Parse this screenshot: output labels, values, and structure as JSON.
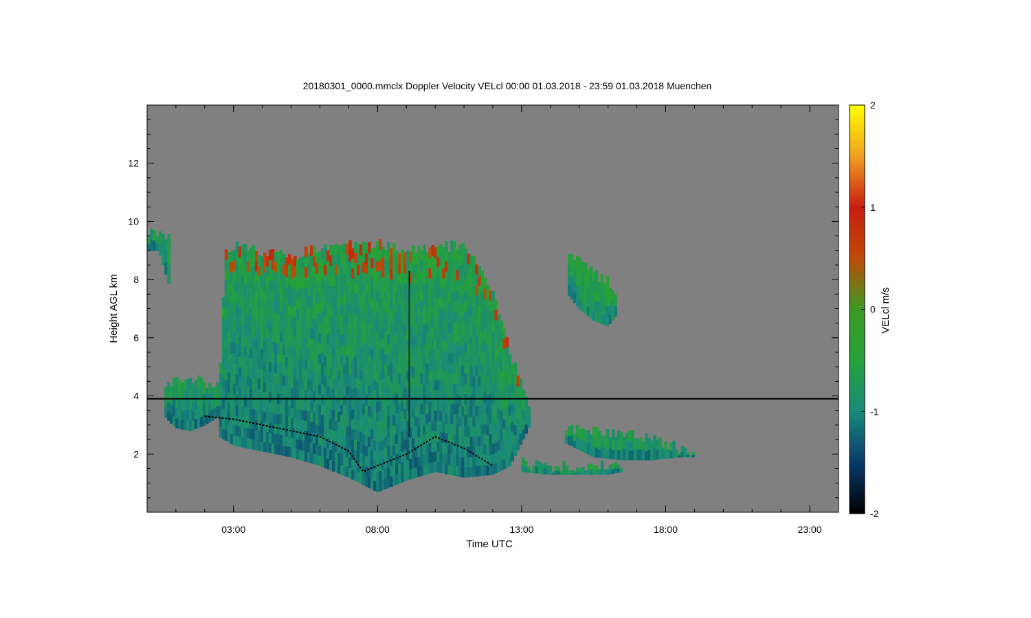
{
  "chart_data": {
    "type": "heatmap",
    "title": "20180301_0000.mmclx Doppler Velocity VELcl   00:00 01.03.2018 - 23:59 01.03.2018 Muenchen",
    "xlabel": "Time UTC",
    "ylabel": "Height AGL km",
    "colorbar_label": "VELcl m/s",
    "xlim": [
      "00:00",
      "24:00"
    ],
    "xlim_hours": [
      0,
      24
    ],
    "ylim": [
      0,
      14
    ],
    "clim": [
      -2,
      2
    ],
    "x_ticks": [
      {
        "value": 3,
        "label": "03:00"
      },
      {
        "value": 8,
        "label": "08:00"
      },
      {
        "value": 13,
        "label": "13:00"
      },
      {
        "value": 18,
        "label": "18:00"
      },
      {
        "value": 23,
        "label": "23:00"
      }
    ],
    "y_ticks": [
      {
        "value": 2,
        "label": "2"
      },
      {
        "value": 4,
        "label": "4"
      },
      {
        "value": 6,
        "label": "6"
      },
      {
        "value": 8,
        "label": "8"
      },
      {
        "value": 10,
        "label": "10"
      },
      {
        "value": 12,
        "label": "12"
      }
    ],
    "colorbar_ticks": [
      {
        "value": 2,
        "label": "2"
      },
      {
        "value": 1,
        "label": "1"
      },
      {
        "value": 0,
        "label": "0"
      },
      {
        "value": -1,
        "label": "-1"
      },
      {
        "value": -2,
        "label": "-2"
      }
    ],
    "colormap": [
      "#000000",
      "#083a6c",
      "#1a8a7a",
      "#26a23a",
      "#3c9a24",
      "#c04a08",
      "#c81e10",
      "#f0a020",
      "#ffff00"
    ],
    "background_color": "#808080",
    "cloud_regions": [
      {
        "name": "main-cloud-system",
        "t": [
          2.5,
          2.7,
          3.0,
          4.0,
          5.0,
          6.0,
          7.0,
          8.0,
          9.0,
          10.0,
          11.0,
          12.0,
          12.6,
          13.3
        ],
        "top": [
          4.0,
          8.8,
          9.2,
          9.0,
          8.8,
          9.1,
          9.2,
          9.3,
          9.0,
          9.1,
          9.2,
          7.5,
          5.5,
          3.6
        ],
        "base": [
          2.6,
          2.5,
          2.3,
          2.1,
          1.9,
          1.6,
          1.2,
          0.7,
          1.1,
          1.4,
          1.2,
          1.3,
          1.6,
          3.0
        ],
        "mean_velocity": -0.6
      },
      {
        "name": "early-low-cloud",
        "t": [
          0.6,
          1.0,
          1.5,
          2.0,
          2.5
        ],
        "top": [
          4.4,
          4.6,
          4.6,
          4.5,
          4.3
        ],
        "base": [
          3.3,
          2.9,
          2.8,
          3.0,
          3.3
        ],
        "mean_velocity": -0.6
      },
      {
        "name": "early-high-cloud",
        "t": [
          0.0,
          0.4,
          0.8
        ],
        "top": [
          9.6,
          9.7,
          9.5
        ],
        "base": [
          9.0,
          9.0,
          7.7
        ],
        "mean_velocity": -0.5
      },
      {
        "name": "mid-level-cloud-14h-16h",
        "t": [
          14.6,
          15.0,
          15.5,
          16.0,
          16.3
        ],
        "top": [
          8.8,
          8.6,
          8.2,
          8.0,
          7.6
        ],
        "base": [
          7.5,
          7.0,
          6.6,
          6.4,
          6.8
        ],
        "mean_velocity": -0.4
      },
      {
        "name": "low-cloud-14h-19h",
        "t": [
          14.5,
          15.5,
          16.5,
          17.5,
          18.5,
          19.0
        ],
        "top": [
          2.9,
          2.8,
          2.7,
          2.5,
          2.2,
          2.0
        ],
        "base": [
          2.4,
          1.9,
          1.8,
          1.8,
          1.9,
          1.9
        ],
        "mean_velocity": -0.5
      },
      {
        "name": "low-cloud-13h-16h",
        "t": [
          13.0,
          14.0,
          15.0,
          16.0,
          16.5
        ],
        "top": [
          1.7,
          1.6,
          1.6,
          1.6,
          1.5
        ],
        "base": [
          1.4,
          1.3,
          1.3,
          1.3,
          1.4
        ],
        "mean_velocity": -0.5
      }
    ],
    "line_features": [
      {
        "name": "melting-layer-line",
        "t": [
          0,
          24
        ],
        "h": [
          3.9,
          3.9
        ]
      },
      {
        "name": "cloud-base-trace",
        "t": [
          2.0,
          3.0,
          4.0,
          5.0,
          6.0,
          7.0,
          7.5,
          8.0,
          9.0,
          10.0,
          11.0,
          12.0
        ],
        "h": [
          3.3,
          3.2,
          3.0,
          2.8,
          2.6,
          2.1,
          1.4,
          1.6,
          2.0,
          2.6,
          2.2,
          1.6
        ]
      },
      {
        "name": "vertical-artifact-line",
        "t": [
          9.1,
          9.1
        ],
        "h": [
          2.6,
          8.3
        ]
      }
    ]
  }
}
